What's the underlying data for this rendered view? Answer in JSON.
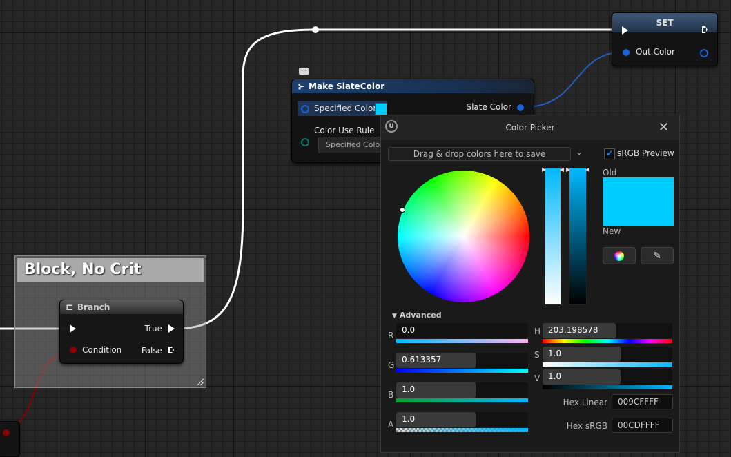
{
  "comment": {
    "title": "Block, No Crit"
  },
  "branch_node": {
    "title": "Branch",
    "true_label": "True",
    "false_label": "False",
    "condition_label": "Condition"
  },
  "make_node": {
    "title": "Make SlateColor",
    "specified_color_label": "Specified Color",
    "slate_color_label": "Slate Color",
    "color_use_rule_label": "Color Use Rule",
    "color_use_rule_value": "Specified Color",
    "swatch_color": "#00CDFF"
  },
  "set_node": {
    "title": "SET",
    "out_color_label": "Out Color"
  },
  "picker": {
    "title": "Color Picker",
    "save_placeholder": "Drag & drop colors here to save",
    "srgb_preview_label": "sRGB Preview",
    "srgb_preview_checked": true,
    "old_label": "Old",
    "new_label": "New",
    "old_color": "#00CDFF",
    "new_color": "#00CDFF",
    "advanced_label": "Advanced",
    "channels": {
      "r": {
        "label": "R",
        "value": "0.0",
        "fraction": 0.0
      },
      "g": {
        "label": "G",
        "value": "0.613357",
        "fraction": 0.613357
      },
      "b": {
        "label": "B",
        "value": "1.0",
        "fraction": 1.0
      },
      "a": {
        "label": "A",
        "value": "1.0",
        "fraction": 1.0
      },
      "h": {
        "label": "H",
        "value": "203.198578",
        "fraction": 0.5644
      },
      "s": {
        "label": "S",
        "value": "1.0",
        "fraction": 1.0
      },
      "v": {
        "label": "V",
        "value": "1.0",
        "fraction": 1.0
      }
    },
    "hex_linear_label": "Hex Linear",
    "hex_linear_value": "009CFFFF",
    "hex_srgb_label": "Hex sRGB",
    "hex_srgb_value": "00CDFFFF",
    "icons": {
      "close": "close-icon",
      "logo": "unreal-logo-icon",
      "color_wheel": "color-wheel-icon",
      "eyedropper": "eyedropper-icon",
      "chevron": "chevron-down-icon"
    }
  },
  "colors": {
    "accent_blue": "#1F6FD0",
    "bool_red": "#8B0000",
    "exec_white": "#FFFFFF"
  }
}
